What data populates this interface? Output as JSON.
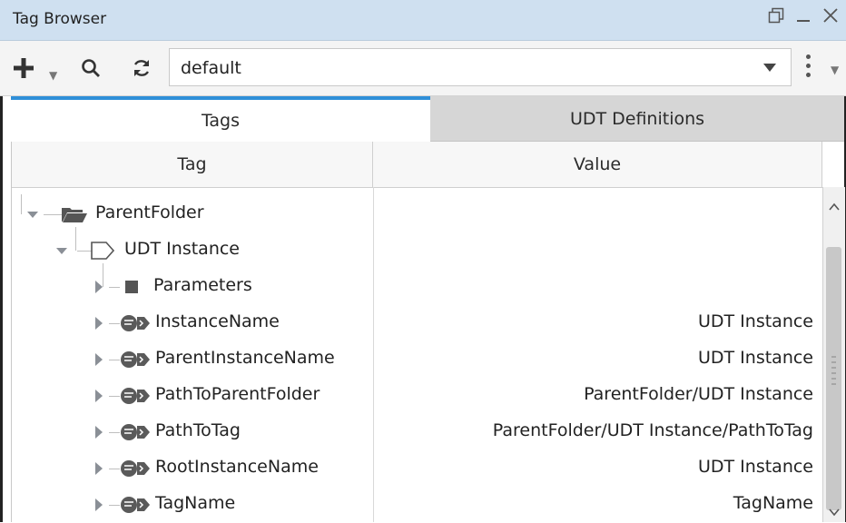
{
  "window": {
    "title": "Tag Browser",
    "controls": [
      "restore-icon",
      "minimize-icon",
      "close-icon"
    ]
  },
  "toolbar": {
    "add_icon": "plus-icon",
    "search_icon": "search-icon",
    "refresh_icon": "refresh-icon",
    "provider_value": "default",
    "menu_icon": "kebab-menu-icon"
  },
  "tabs": [
    {
      "label": "Tags",
      "selected": true
    },
    {
      "label": "UDT Definitions",
      "selected": false
    }
  ],
  "table": {
    "columns": [
      "Tag",
      "Value"
    ],
    "rows": [
      {
        "label": "ParentFolder",
        "value": "",
        "icon": "folder-open-icon",
        "expanded": true,
        "depth": 0
      },
      {
        "label": "UDT Instance",
        "value": "",
        "icon": "udt-instance-icon",
        "expanded": true,
        "depth": 1
      },
      {
        "label": "Parameters",
        "value": "",
        "icon": "parameters-icon",
        "expanded": false,
        "depth": 2
      },
      {
        "label": "InstanceName",
        "value": "UDT Instance",
        "icon": "expression-tag-icon",
        "expanded": false,
        "depth": 2
      },
      {
        "label": "ParentInstanceName",
        "value": "UDT Instance",
        "icon": "expression-tag-icon",
        "expanded": false,
        "depth": 2
      },
      {
        "label": "PathToParentFolder",
        "value": "ParentFolder/UDT Instance",
        "icon": "expression-tag-icon",
        "expanded": false,
        "depth": 2
      },
      {
        "label": "PathToTag",
        "value": "ParentFolder/UDT Instance/PathToTag",
        "icon": "expression-tag-icon",
        "expanded": false,
        "depth": 2
      },
      {
        "label": "RootInstanceName",
        "value": "UDT Instance",
        "icon": "expression-tag-icon",
        "expanded": false,
        "depth": 2
      },
      {
        "label": "TagName",
        "value": "TagName",
        "icon": "expression-tag-icon",
        "expanded": false,
        "depth": 2
      }
    ]
  },
  "colors": {
    "title_bar": "#cfe0f0",
    "tab_accent": "#2f8fd8",
    "inactive_tab": "#d6d6d6"
  }
}
